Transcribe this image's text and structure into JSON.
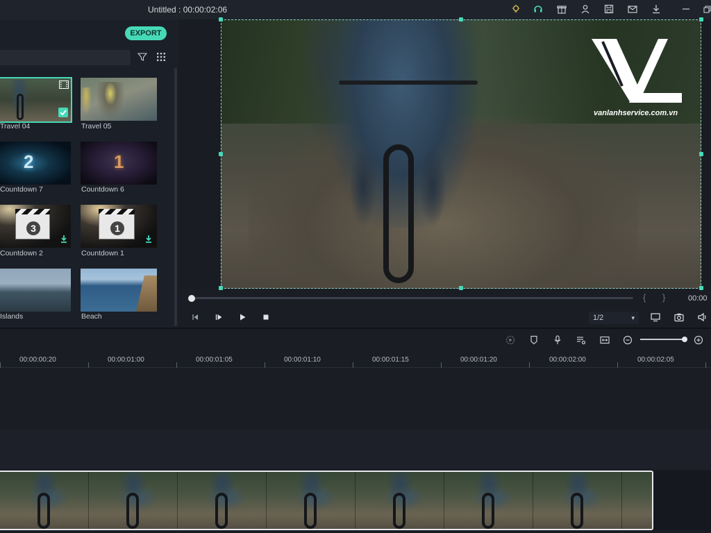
{
  "window": {
    "title": "Untitled : 00:00:02:06"
  },
  "titlebar_icons": [
    "bulb-icon",
    "headset-icon",
    "gift-icon",
    "account-icon",
    "save-icon",
    "mail-icon",
    "download-icon",
    "minimize-icon",
    "restore-icon"
  ],
  "media_panel": {
    "export_label": "EXPORT",
    "items": [
      {
        "label": "Travel 04",
        "selected": true,
        "badge": "film-icon",
        "check": true
      },
      {
        "label": "Travel 05",
        "selected": false
      },
      {
        "label": "Countdown 7",
        "overlay": "2"
      },
      {
        "label": "Countdown 6",
        "overlay": "1"
      },
      {
        "label": "Countdown 2",
        "overlay": "3",
        "download": true
      },
      {
        "label": "Countdown 1",
        "overlay": "1",
        "download": true
      },
      {
        "label": "Islands"
      },
      {
        "label": "Beach"
      }
    ]
  },
  "preview": {
    "watermark_text": "vanlanhservice.com.vn",
    "time_right": "00:00",
    "bracket_left": "{",
    "bracket_right": "}",
    "playhead": 0.0,
    "scale": "1/2",
    "controls": [
      "prev-frame-icon",
      "play-step-icon",
      "play-icon",
      "stop-icon"
    ]
  },
  "timeline": {
    "toolbar_icons": [
      "render-icon",
      "marker-icon",
      "mic-icon",
      "voiceover-icon",
      "fit-icon",
      "zoom-out-icon",
      "zoom-in-icon"
    ],
    "zoom_level": 0.9,
    "ruler": [
      "00:00:00:20",
      "00:00:01:00",
      "00:00:01:05",
      "00:00:01:10",
      "00:00:01:15",
      "00:00:01:20",
      "00:00:02:00",
      "00:00:02:05"
    ]
  },
  "colors": {
    "accent": "#46d9b8",
    "background": "#1a1d24"
  }
}
